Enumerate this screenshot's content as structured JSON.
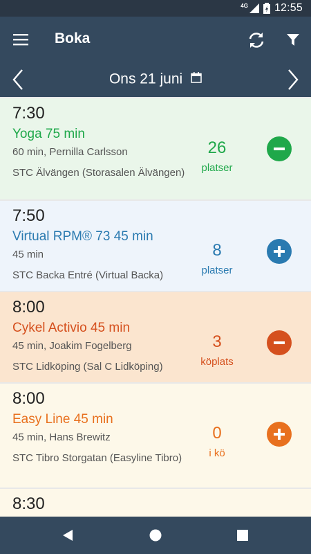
{
  "status_bar": {
    "network": "4G",
    "time": "12:55"
  },
  "app_bar": {
    "title": "Boka",
    "icons": [
      "menu-icon",
      "refresh-icon",
      "filter-icon"
    ]
  },
  "date_bar": {
    "date": "Ons 21 juni",
    "icons": [
      "chevron-left-icon",
      "calendar-icon",
      "chevron-right-icon"
    ]
  },
  "classes": [
    {
      "time": "7:30",
      "name": "Yoga 75 min",
      "info": "60 min, Pernilla Carlsson",
      "location": "STC Älvängen  (Storasalen Älvängen)",
      "count": "26",
      "count_label": "platser",
      "action": "minus",
      "color": "#1fa84a",
      "background": "#eaf6ea"
    },
    {
      "time": "7:50",
      "name": "Virtual RPM® 73 45 min",
      "info": "45 min",
      "location": "STC Backa Entré  (Virtual Backa)",
      "count": "8",
      "count_label": "platser",
      "action": "plus",
      "color": "#2a7ab0",
      "background": "#eef4fb"
    },
    {
      "time": "8:00",
      "name": "Cykel Activio 45 min",
      "info": "45 min, Joakim Fogelberg",
      "location": "STC Lidköping  (Sal C Lidköping)",
      "count": "3",
      "count_label": "köplats",
      "action": "minus",
      "color": "#d5501e",
      "background": "#fbe5cf"
    },
    {
      "time": "8:00",
      "name": "Easy Line 45 min",
      "info": "45 min, Hans Brewitz",
      "location": "STC Tibro Storgatan  (Easyline Tibro)",
      "count": "0",
      "count_label": "i kö",
      "action": "plus",
      "color": "#e8701e",
      "background": "#fdf8e9"
    },
    {
      "time": "8:30",
      "name": "",
      "info": "",
      "location": "",
      "count": "",
      "count_label": "",
      "action": "",
      "color": "#222222",
      "background": "#fdf8e9"
    }
  ],
  "nav_bar": {
    "icons": [
      "back-icon",
      "home-icon",
      "recents-icon"
    ]
  }
}
